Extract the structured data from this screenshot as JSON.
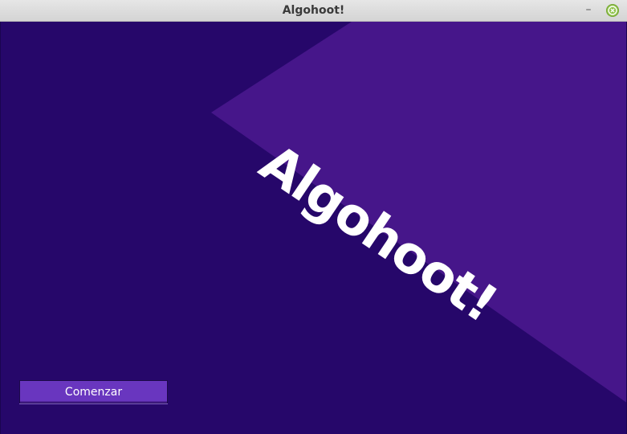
{
  "window": {
    "title": "Algohoot!",
    "controls": {
      "minimize_glyph": "–",
      "close_icon": "close-icon"
    }
  },
  "main": {
    "logo_text": "Algohoot!",
    "start_button_label": "Comenzar"
  },
  "colors": {
    "background_dark": "#26076a",
    "triangle_light": "#46168a",
    "button_fill": "#6936bf",
    "close_button_green": "#8fc34a"
  }
}
